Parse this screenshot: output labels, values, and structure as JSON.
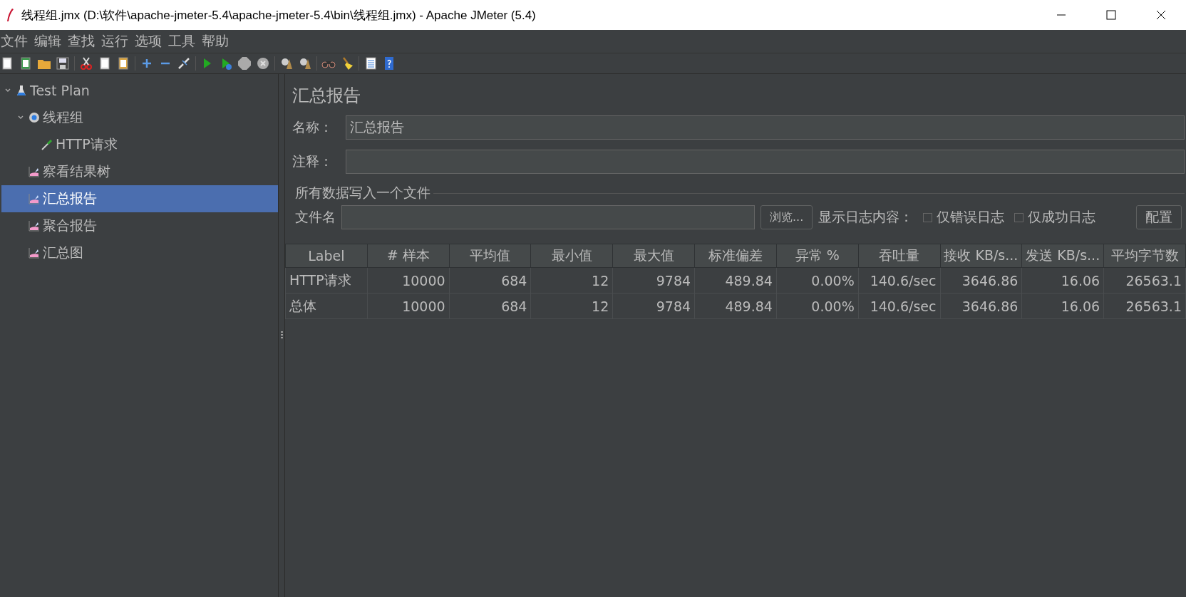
{
  "window": {
    "title": "线程组.jmx (D:\\软件\\apache-jmeter-5.4\\apache-jmeter-5.4\\bin\\线程组.jmx) - Apache JMeter (5.4)"
  },
  "menu": [
    "文件",
    "编辑",
    "查找",
    "运行",
    "选项",
    "工具",
    "帮助"
  ],
  "tree": [
    {
      "label": "Test Plan",
      "kind": "plan",
      "expanded": true,
      "selected": false,
      "children": [
        {
          "label": "线程组",
          "kind": "thread-group",
          "expanded": true,
          "selected": false,
          "children": [
            {
              "label": "HTTP请求",
              "kind": "sampler",
              "selected": false
            }
          ]
        },
        {
          "label": "察看结果树",
          "kind": "listener",
          "selected": false
        },
        {
          "label": "汇总报告",
          "kind": "listener",
          "selected": true
        },
        {
          "label": "聚合报告",
          "kind": "listener",
          "selected": false
        },
        {
          "label": "汇总图",
          "kind": "listener",
          "selected": false
        }
      ]
    }
  ],
  "panel": {
    "title": "汇总报告",
    "name_label": "名称：",
    "name_value": "汇总报告",
    "comment_label": "注释：",
    "file_section": "所有数据写入一个文件",
    "file_label": "文件名",
    "browse": "浏览...",
    "log_label": "显示日志内容：",
    "checkboxes": [
      {
        "label": "仅错误日志",
        "checked": false
      },
      {
        "label": "仅成功日志",
        "checked": false
      }
    ],
    "config": "配置"
  },
  "table": {
    "columns": [
      "Label",
      "# 样本",
      "平均值",
      "最小值",
      "最大值",
      "标准偏差",
      "异常 %",
      "吞吐量",
      "接收 KB/s...",
      "发送 KB/s...",
      "平均字节数"
    ],
    "rows": [
      [
        "HTTP请求",
        "10000",
        "684",
        "12",
        "9784",
        "489.84",
        "0.00%",
        "140.6/sec",
        "3646.86",
        "16.06",
        "26563.1"
      ],
      [
        "总体",
        "10000",
        "684",
        "12",
        "9784",
        "489.84",
        "0.00%",
        "140.6/sec",
        "3646.86",
        "16.06",
        "26563.1"
      ]
    ]
  }
}
